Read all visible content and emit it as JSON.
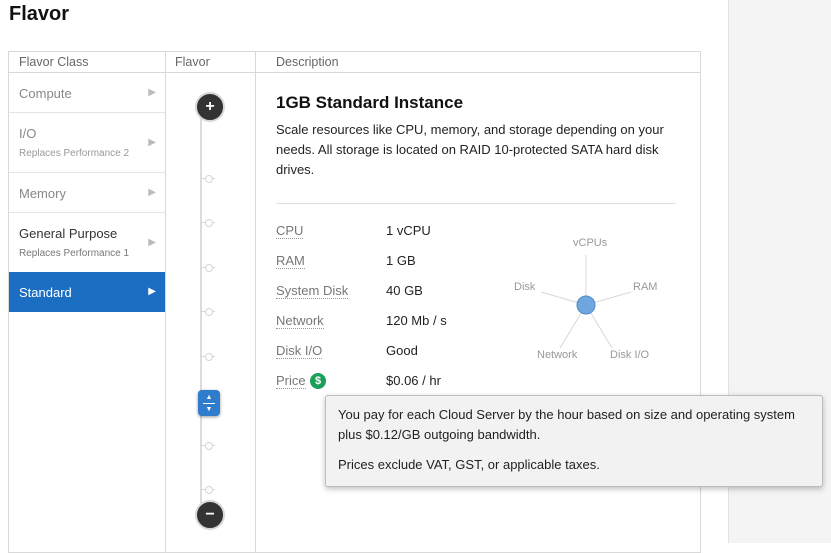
{
  "page": {
    "title": "Flavor"
  },
  "columns": {
    "flavor_class": "Flavor Class",
    "flavor": "Flavor",
    "description": "Description"
  },
  "flavor_classes": [
    {
      "label": "Compute",
      "sublabel": ""
    },
    {
      "label": "I/O",
      "sublabel": "Replaces Performance 2"
    },
    {
      "label": "Memory",
      "sublabel": ""
    },
    {
      "label": "General Purpose",
      "sublabel": "Replaces Performance 1"
    },
    {
      "label": "Standard",
      "sublabel": ""
    }
  ],
  "active_class": "Standard",
  "slider": {
    "increase_symbol": "+",
    "decrease_symbol": "−",
    "handle_icon": "up-down-arrows"
  },
  "description": {
    "title": "1GB Standard Instance",
    "text": "Scale resources like CPU, memory, and storage depending on your needs. All storage is located on RAID 10-protected SATA hard disk drives."
  },
  "specs": [
    {
      "label": "CPU",
      "value": "1 vCPU"
    },
    {
      "label": "RAM",
      "value": "1 GB"
    },
    {
      "label": "System Disk",
      "value": "40 GB"
    },
    {
      "label": "Network",
      "value": "120 Mb / s"
    },
    {
      "label": "Disk I/O",
      "value": "Good"
    },
    {
      "label": "Price",
      "value": "$0.06 / hr"
    }
  ],
  "price_icon_symbol": "$",
  "radar": {
    "axes": [
      "vCPUs",
      "RAM",
      "Disk I/O",
      "Network",
      "Disk"
    ]
  },
  "tooltip": {
    "line1": "You pay for each Cloud Server by the hour based on size and operating system plus $0.12/GB outgoing bandwidth.",
    "line2": "Prices exclude VAT, GST, or applicable taxes."
  },
  "colors": {
    "accent": "#1b6ec2",
    "handle": "#2f7ccc",
    "price_icon": "#1aa05a",
    "radar_point": "#6fa6e0"
  }
}
